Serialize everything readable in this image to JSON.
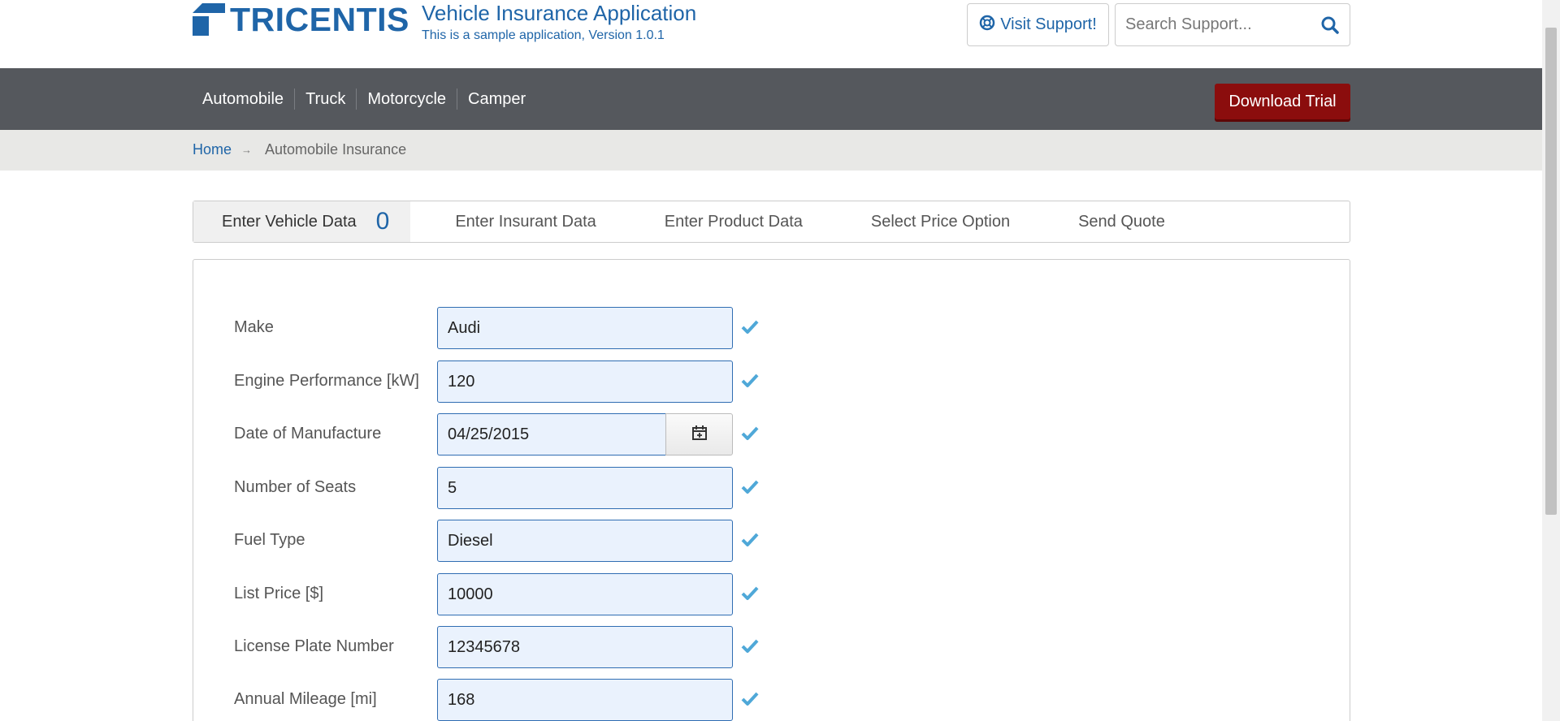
{
  "header": {
    "logo_text": "TRICENTIS",
    "app_title": "Vehicle Insurance Application",
    "app_subtitle": "This is a sample application, Version 1.0.1",
    "support_label": "Visit Support!",
    "search_placeholder": "Search Support..."
  },
  "nav": {
    "items": [
      {
        "label": "Automobile"
      },
      {
        "label": "Truck"
      },
      {
        "label": "Motorcycle"
      },
      {
        "label": "Camper"
      }
    ],
    "download_label": "Download Trial"
  },
  "breadcrumb": {
    "home": "Home",
    "separator": "→",
    "current": "Automobile Insurance"
  },
  "tabs": {
    "items": [
      {
        "label": "Enter Vehicle Data",
        "count": "0"
      },
      {
        "label": "Enter Insurant Data"
      },
      {
        "label": "Enter Product Data"
      },
      {
        "label": "Select Price Option"
      },
      {
        "label": "Send Quote"
      }
    ]
  },
  "form": {
    "fields": [
      {
        "label": "Make",
        "value": "Audi"
      },
      {
        "label": "Engine Performance [kW]",
        "value": "120"
      },
      {
        "label": "Date of Manufacture",
        "value": "04/25/2015"
      },
      {
        "label": "Number of Seats",
        "value": "5"
      },
      {
        "label": "Fuel Type",
        "value": "Diesel"
      },
      {
        "label": "List Price [$]",
        "value": "10000"
      },
      {
        "label": "License Plate Number",
        "value": "12345678"
      },
      {
        "label": "Annual Mileage [mi]",
        "value": "168"
      }
    ]
  },
  "icons": {
    "support": "lifebuoy-icon",
    "search": "search-icon",
    "calendar": "calendar-icon",
    "valid": "checkmark-icon"
  },
  "colors": {
    "brand": "#1f65a8",
    "navbar": "#55585d",
    "download": "#8b0d0d",
    "check": "#4fa8d8",
    "input_bg": "#eaf2fd"
  }
}
